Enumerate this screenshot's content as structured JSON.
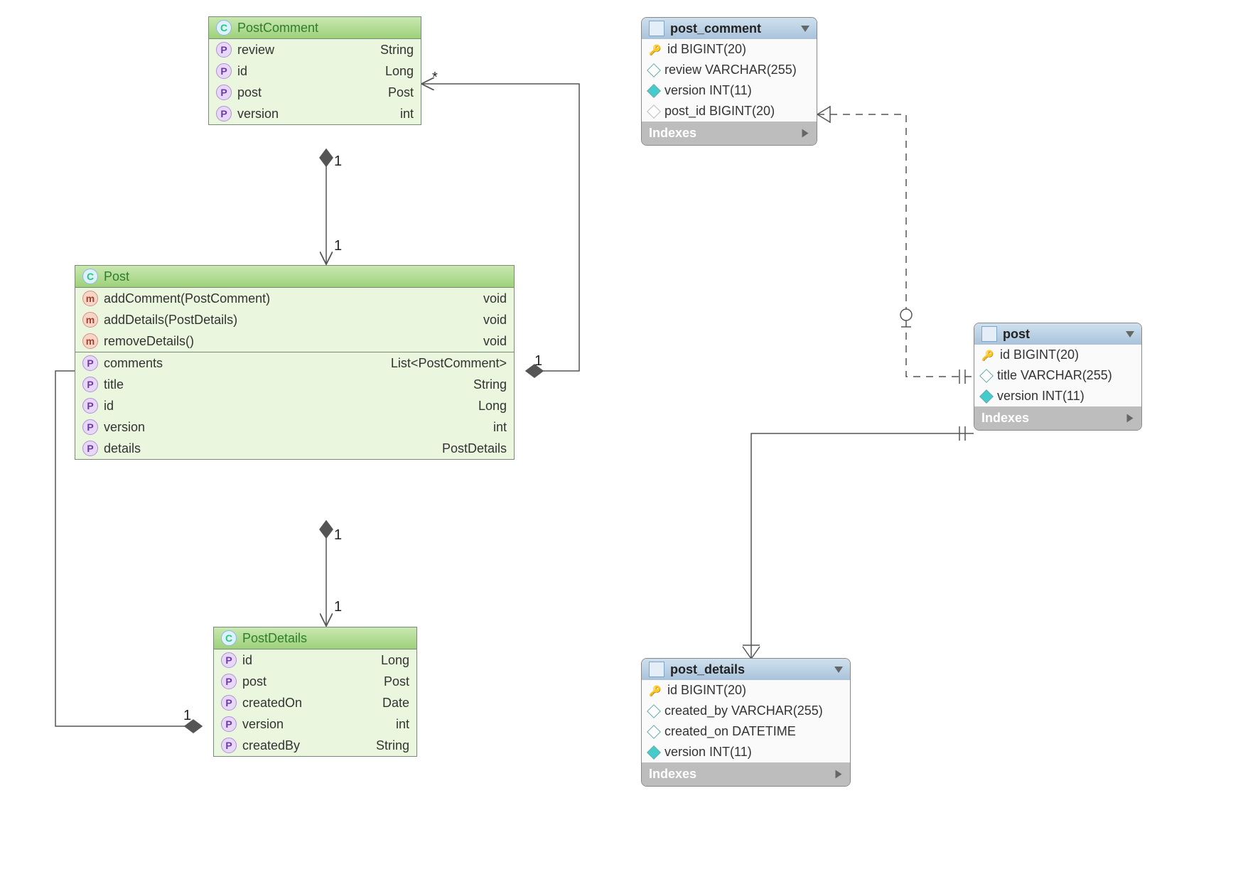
{
  "classes": {
    "postComment": {
      "name": "PostComment",
      "props": [
        {
          "name": "review",
          "type": "String"
        },
        {
          "name": "id",
          "type": "Long"
        },
        {
          "name": "post",
          "type": "Post"
        },
        {
          "name": "version",
          "type": "int"
        }
      ]
    },
    "post": {
      "name": "Post",
      "methods": [
        {
          "sig": "addComment(PostComment)",
          "ret": "void"
        },
        {
          "sig": "addDetails(PostDetails)",
          "ret": "void"
        },
        {
          "sig": "removeDetails()",
          "ret": "void"
        }
      ],
      "props": [
        {
          "name": "comments",
          "type": "List<PostComment>"
        },
        {
          "name": "title",
          "type": "String"
        },
        {
          "name": "id",
          "type": "Long"
        },
        {
          "name": "version",
          "type": "int"
        },
        {
          "name": "details",
          "type": "PostDetails"
        }
      ]
    },
    "postDetails": {
      "name": "PostDetails",
      "props": [
        {
          "name": "id",
          "type": "Long"
        },
        {
          "name": "post",
          "type": "Post"
        },
        {
          "name": "createdOn",
          "type": "Date"
        },
        {
          "name": "version",
          "type": "int"
        },
        {
          "name": "createdBy",
          "type": "String"
        }
      ]
    }
  },
  "tables": {
    "postComment": {
      "name": "post_comment",
      "cols": [
        {
          "name": "id BIGINT(20)",
          "k": "pk"
        },
        {
          "name": "review VARCHAR(255)",
          "k": "col"
        },
        {
          "name": "version INT(11)",
          "k": "req"
        },
        {
          "name": "post_id BIGINT(20)",
          "k": "fk"
        }
      ],
      "indexes": "Indexes"
    },
    "post": {
      "name": "post",
      "cols": [
        {
          "name": "id BIGINT(20)",
          "k": "pk"
        },
        {
          "name": "title VARCHAR(255)",
          "k": "col"
        },
        {
          "name": "version INT(11)",
          "k": "req"
        }
      ],
      "indexes": "Indexes"
    },
    "postDetails": {
      "name": "post_details",
      "cols": [
        {
          "name": "id BIGINT(20)",
          "k": "rk"
        },
        {
          "name": "created_by VARCHAR(255)",
          "k": "col"
        },
        {
          "name": "created_on DATETIME",
          "k": "col"
        },
        {
          "name": "version INT(11)",
          "k": "req"
        }
      ],
      "indexes": "Indexes"
    }
  },
  "multiplicities": {
    "star": "*",
    "one": "1"
  },
  "chart_data": {
    "type": "diagram",
    "uml_classes": [
      {
        "name": "PostComment",
        "attributes": [
          "review:String",
          "id:Long",
          "post:Post",
          "version:int"
        ],
        "methods": []
      },
      {
        "name": "Post",
        "attributes": [
          "comments:List<PostComment>",
          "title:String",
          "id:Long",
          "version:int",
          "details:PostDetails"
        ],
        "methods": [
          "addComment(PostComment):void",
          "addDetails(PostDetails):void",
          "removeDetails():void"
        ]
      },
      {
        "name": "PostDetails",
        "attributes": [
          "id:Long",
          "post:Post",
          "createdOn:Date",
          "version:int",
          "createdBy:String"
        ],
        "methods": []
      }
    ],
    "uml_relations": [
      {
        "from": "Post",
        "to": "PostComment",
        "type": "composition",
        "from_mult": "1",
        "to_mult": "*"
      },
      {
        "from": "PostComment",
        "to": "Post",
        "type": "composition",
        "from_mult": "1",
        "to_mult": "1"
      },
      {
        "from": "Post",
        "to": "PostDetails",
        "type": "composition",
        "from_mult": "1",
        "to_mult": "1"
      },
      {
        "from": "PostDetails",
        "to": "Post",
        "type": "composition",
        "from_mult": "1",
        "to_mult": "1"
      }
    ],
    "db_tables": [
      {
        "name": "post_comment",
        "columns": [
          {
            "name": "id",
            "type": "BIGINT(20)",
            "pk": true
          },
          {
            "name": "review",
            "type": "VARCHAR(255)"
          },
          {
            "name": "version",
            "type": "INT(11)",
            "notnull": true
          },
          {
            "name": "post_id",
            "type": "BIGINT(20)",
            "fk": "post.id"
          }
        ]
      },
      {
        "name": "post",
        "columns": [
          {
            "name": "id",
            "type": "BIGINT(20)",
            "pk": true
          },
          {
            "name": "title",
            "type": "VARCHAR(255)"
          },
          {
            "name": "version",
            "type": "INT(11)",
            "notnull": true
          }
        ]
      },
      {
        "name": "post_details",
        "columns": [
          {
            "name": "id",
            "type": "BIGINT(20)",
            "pk": true,
            "fk": "post.id"
          },
          {
            "name": "created_by",
            "type": "VARCHAR(255)"
          },
          {
            "name": "created_on",
            "type": "DATETIME"
          },
          {
            "name": "version",
            "type": "INT(11)",
            "notnull": true
          }
        ]
      }
    ],
    "db_relations": [
      {
        "from": "post_comment",
        "to": "post",
        "cardinality": "many-to-one",
        "identifying": false
      },
      {
        "from": "post_details",
        "to": "post",
        "cardinality": "one-to-one",
        "identifying": true
      }
    ]
  }
}
